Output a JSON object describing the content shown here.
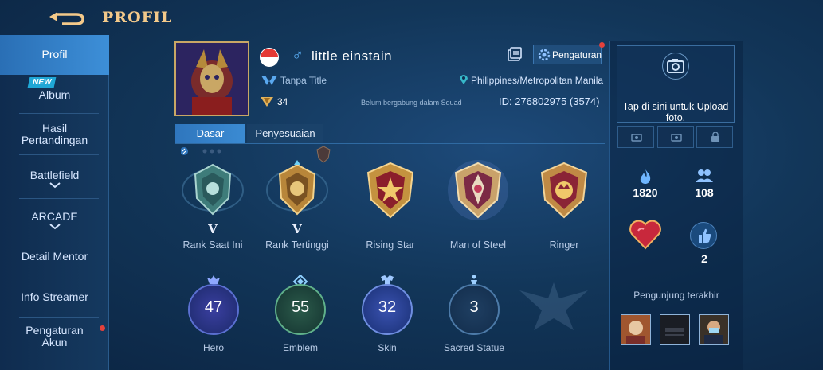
{
  "header": {
    "title": "PROFIL"
  },
  "sidebar": {
    "items": [
      {
        "label": "Profil",
        "active": true
      },
      {
        "label": "Album",
        "badge": "NEW"
      },
      {
        "label": "Hasil Pertandingan"
      },
      {
        "label": "Battlefield",
        "has_arrow": true
      },
      {
        "label": "ARCADE",
        "has_arrow": true
      },
      {
        "label": "Detail Mentor"
      },
      {
        "label": "Info Streamer"
      },
      {
        "label": "Pengaturan Akun",
        "notification_dot": true
      }
    ]
  },
  "profile": {
    "name": "little einstain",
    "gender": "male",
    "flag": "Indonesia",
    "title": "Tanpa Title",
    "level": "34",
    "squad": "Belum bergabung dalam Squad",
    "location": "Philippines/Metropolitan Manila",
    "id": "ID: 276802975 (3574)",
    "settings_label": "Pengaturan"
  },
  "tabs": [
    {
      "label": "Dasar",
      "active": true
    },
    {
      "label": "Penyesuaian",
      "active": false
    }
  ],
  "medals": [
    {
      "label": "Rank Saat Ini",
      "roman": "V",
      "icon": "epic-rank-icon"
    },
    {
      "label": "Rank Tertinggi",
      "roman": "V",
      "icon": "legend-rank-icon"
    },
    {
      "label": "Rising Star",
      "roman": "",
      "icon": "rising-star-medal-icon"
    },
    {
      "label": "Man of Steel",
      "roman": "",
      "icon": "man-of-steel-medal-icon"
    },
    {
      "label": "Ringer",
      "roman": "",
      "icon": "ringer-medal-icon"
    }
  ],
  "stats": [
    {
      "label": "Hero",
      "value": "47"
    },
    {
      "label": "Emblem",
      "value": "55"
    },
    {
      "label": "Skin",
      "value": "32"
    },
    {
      "label": "Sacred Statue",
      "value": "3"
    }
  ],
  "right_panel": {
    "upload_text": "Tap di sini untuk Upload foto.",
    "popularity": "1820",
    "followers": "108",
    "likes": "2",
    "visitors_label": "Pengunjung terakhir"
  },
  "colors": {
    "accent": "#3b8bd3",
    "gold": "#f3c98a",
    "notification": "#e4413b"
  }
}
